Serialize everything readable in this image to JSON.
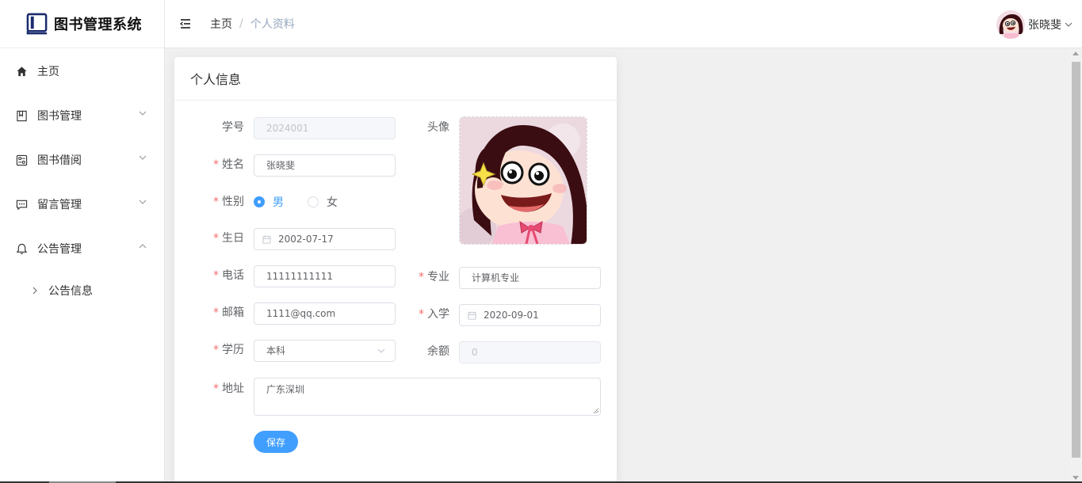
{
  "app": {
    "title": "图书管理系统"
  },
  "sidebar": {
    "items": [
      {
        "label": "主页",
        "icon": "home-icon"
      },
      {
        "label": "图书管理",
        "icon": "book-icon"
      },
      {
        "label": "图书借阅",
        "icon": "borrow-icon"
      },
      {
        "label": "留言管理",
        "icon": "message-icon"
      },
      {
        "label": "公告管理",
        "icon": "bell-icon"
      }
    ],
    "subitems": [
      {
        "label": "公告信息"
      }
    ]
  },
  "header": {
    "breadcrumb": {
      "home": "主页",
      "separator": "/",
      "current": "个人资料"
    },
    "user_name": "张晓斐"
  },
  "card": {
    "title": "个人信息",
    "save_label": "保存"
  },
  "form": {
    "student_id": {
      "label": "学号",
      "value": "2024001"
    },
    "name": {
      "label": "姓名",
      "value": "张晓斐"
    },
    "gender": {
      "label": "性别",
      "options": [
        "男",
        "女"
      ],
      "selected": "男"
    },
    "birthday": {
      "label": "生日",
      "value": "2002-07-17"
    },
    "phone": {
      "label": "电话",
      "value": "11111111111"
    },
    "email": {
      "label": "邮箱",
      "value": "1111@qq.com"
    },
    "education": {
      "label": "学历",
      "value": "本科"
    },
    "address": {
      "label": "地址",
      "value": "广东深圳"
    },
    "avatar": {
      "label": "头像"
    },
    "major": {
      "label": "专业",
      "value": "计算机专业"
    },
    "enroll": {
      "label": "入学",
      "value": "2020-09-01"
    },
    "balance": {
      "label": "余额",
      "value": "0"
    },
    "required_mark": "*"
  },
  "colors": {
    "primary": "#409eff",
    "required": "#f56c6c"
  }
}
